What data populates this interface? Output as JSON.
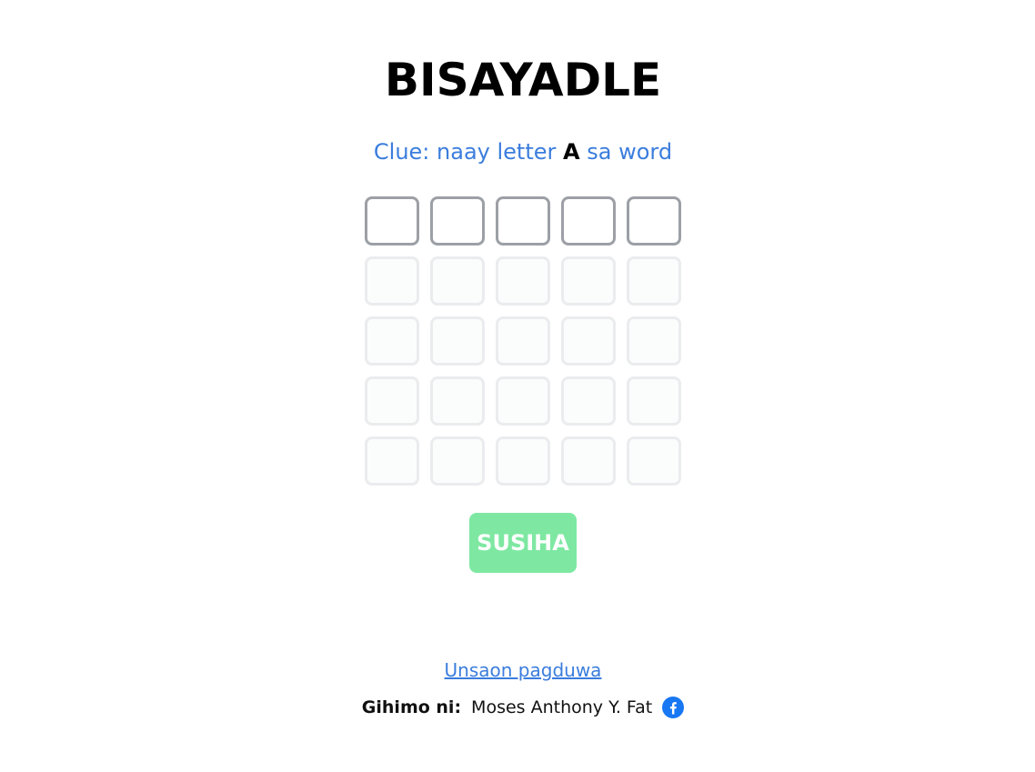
{
  "header": {
    "title": "BISAYADLE"
  },
  "clue": {
    "prefix": "Clue: naay letter",
    "letter": "A",
    "suffix": "sa word"
  },
  "board": {
    "rows": 5,
    "columns": 5,
    "active_row": 1
  },
  "actions": {
    "submit_label": "SUSIHA"
  },
  "footer": {
    "how_to_play": "Unsaon pagduwa",
    "made_by_label": "Gihimo ni:",
    "author": "Moses Anthony Y. Fat",
    "social_icon": "facebook-icon"
  },
  "colors": {
    "accent": "#3b7ddd",
    "submit_bg": "#7ee8a2",
    "active_border": "#9ca0a6",
    "inactive_border": "#eaecee",
    "facebook": "#1877f2"
  }
}
